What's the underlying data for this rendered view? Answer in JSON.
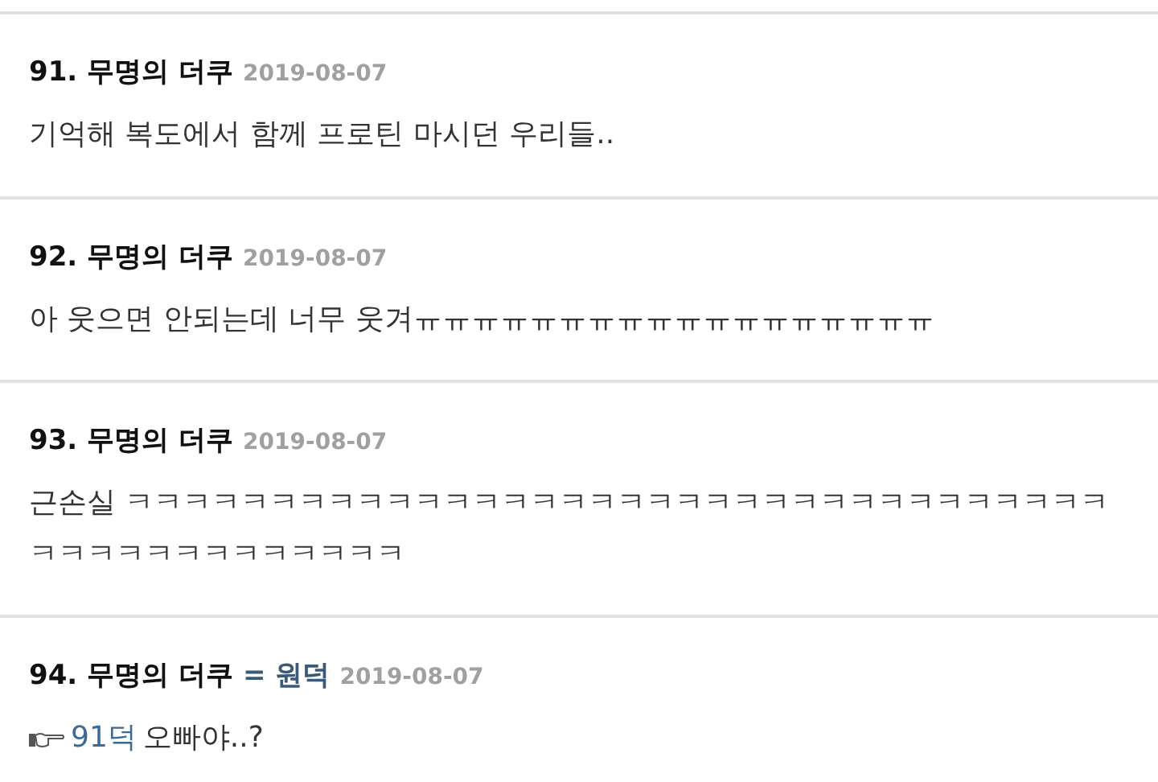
{
  "comments": [
    {
      "number": "91.",
      "author": "무명의 더쿠",
      "date": "2019-08-07",
      "body": "기억해 복도에서 함께 프로틴 마시던 우리들.."
    },
    {
      "number": "92.",
      "author": "무명의 더쿠",
      "date": "2019-08-07",
      "body": "아 웃으면 안되는데 너무 웃겨ㅠㅠㅠㅠㅠㅠㅠㅠㅠㅠㅠㅠㅠㅠㅠㅠㅠㅠ"
    },
    {
      "number": "93.",
      "author": "무명의 더쿠",
      "date": "2019-08-07",
      "body": "근손실 ㅋㅋㅋㅋㅋㅋㅋㅋㅋㅋㅋㅋㅋㅋㅋㅋㅋㅋㅋㅋㅋㅋㅋㅋㅋㅋㅋㅋㅋㅋㅋㅋㅋㅋㅋㅋㅋㅋㅋㅋㅋㅋㅋㅋㅋㅋㅋ"
    },
    {
      "number": "94.",
      "author": "무명의 더쿠",
      "alias": {
        "separator": "=",
        "name": "원덕"
      },
      "date": "2019-08-07",
      "reply_to": "91덕",
      "body": "오빠야..?"
    }
  ]
}
